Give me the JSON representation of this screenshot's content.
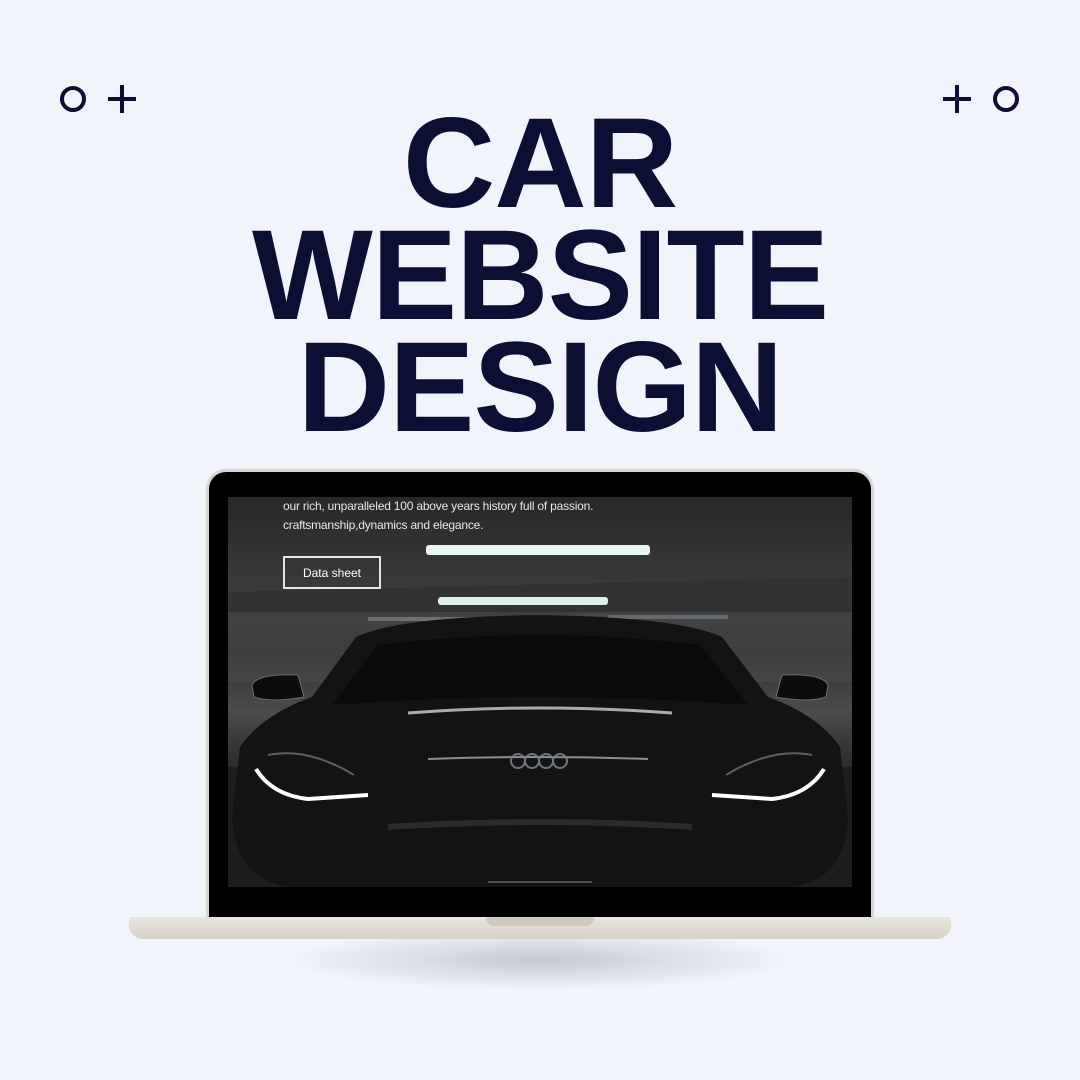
{
  "headline": {
    "line1": "CAR",
    "line2": "WEBSITE",
    "line3": "DESIGN"
  },
  "decorations": {
    "left": [
      "ring-icon",
      "plus-icon"
    ],
    "right": [
      "plus-icon",
      "ring-icon"
    ]
  },
  "screen": {
    "text_line1": "our rich, unparalleled 100 above years history full of passion.",
    "text_line2": "craftsmanship,dynamics and elegance.",
    "button_label": "Data sheet"
  },
  "colors": {
    "background": "#f2f4fb",
    "headline": "#0a0f33",
    "laptop_frame": "#d9d6cd",
    "screen_bezel": "#000000"
  }
}
